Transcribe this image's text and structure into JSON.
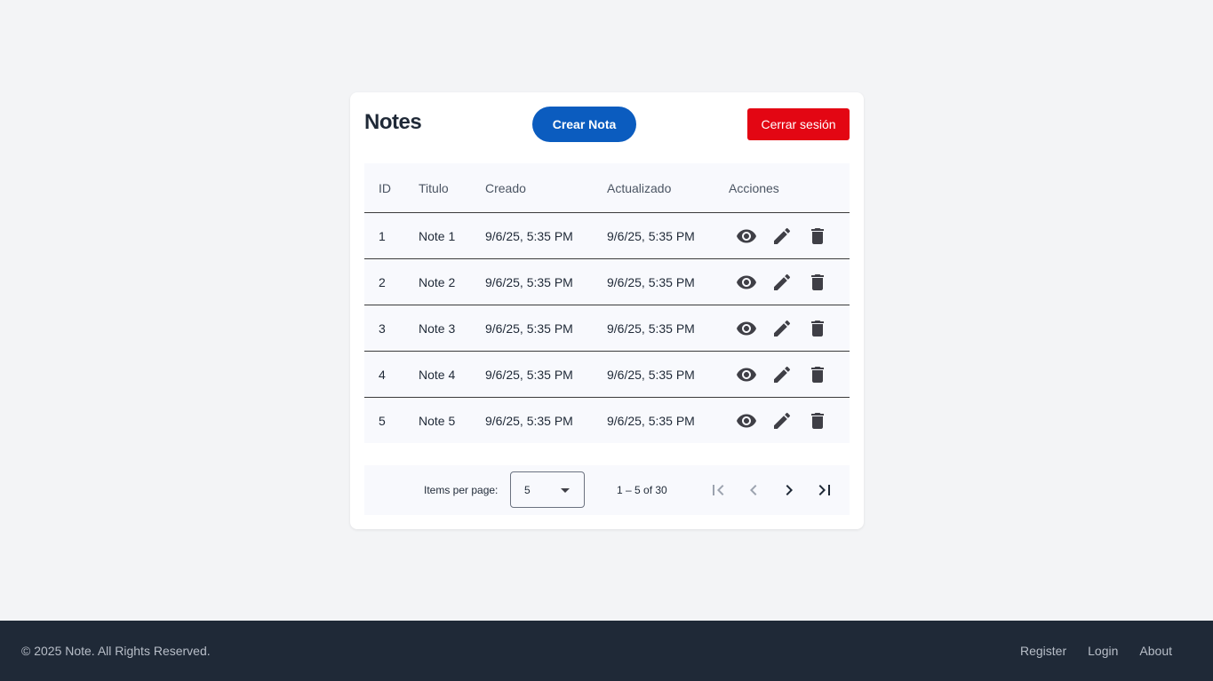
{
  "card": {
    "title": "Notes",
    "create_label": "Crear Nota",
    "logout_label": "Cerrar sesión"
  },
  "table": {
    "headers": {
      "id": "ID",
      "title": "Titulo",
      "created": "Creado",
      "updated": "Actualizado",
      "actions": "Acciones"
    },
    "rows": [
      {
        "id": "1",
        "title": "Note 1",
        "created": "9/6/25, 5:35 PM",
        "updated": "9/6/25, 5:35 PM"
      },
      {
        "id": "2",
        "title": "Note 2",
        "created": "9/6/25, 5:35 PM",
        "updated": "9/6/25, 5:35 PM"
      },
      {
        "id": "3",
        "title": "Note 3",
        "created": "9/6/25, 5:35 PM",
        "updated": "9/6/25, 5:35 PM"
      },
      {
        "id": "4",
        "title": "Note 4",
        "created": "9/6/25, 5:35 PM",
        "updated": "9/6/25, 5:35 PM"
      },
      {
        "id": "5",
        "title": "Note 5",
        "created": "9/6/25, 5:35 PM",
        "updated": "9/6/25, 5:35 PM"
      }
    ],
    "row_icons": [
      "eye-icon",
      "pencil-icon",
      "trash-icon"
    ]
  },
  "paginator": {
    "items_per_page_label": "Items per page:",
    "page_size": "5",
    "range_label": "1 – 5 of 30",
    "icons": [
      "first-page-icon",
      "previous-page-icon",
      "next-page-icon",
      "last-page-icon"
    ]
  },
  "footer": {
    "copyright": "© 2025 Note. All Rights Reserved.",
    "links": [
      "Register",
      "Login",
      "About"
    ]
  },
  "colors": {
    "primary": "#0b5cbf",
    "danger": "#e30613",
    "footer_bg": "#1f2937",
    "page_bg": "#f3f4f6"
  }
}
